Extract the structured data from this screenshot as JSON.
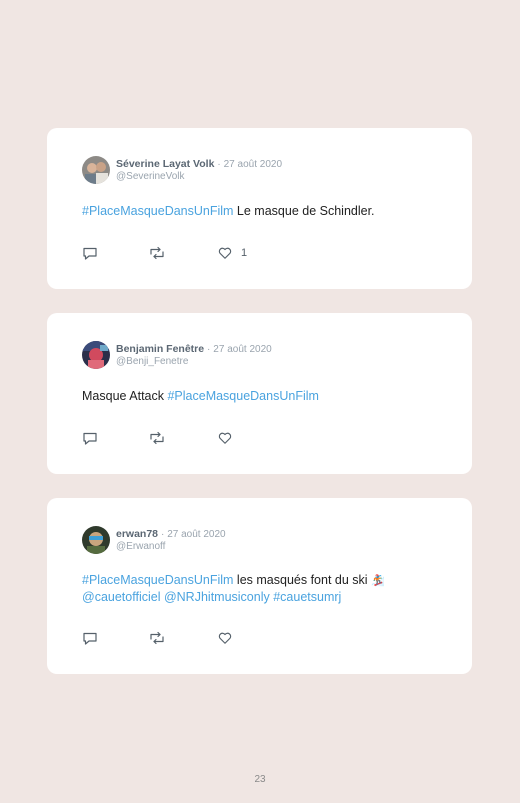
{
  "tweets": [
    {
      "name": "Séverine Layat Volk",
      "date": "27 août 2020",
      "handle": "@SeverineVolk",
      "text_parts": [
        "#PlaceMasqueDansUnFilm",
        " Le masque de Schindler."
      ],
      "like_count": "1"
    },
    {
      "name": "Benjamin Fenêtre",
      "date": "27 août 2020",
      "handle": "@Benji_Fenetre",
      "text_parts": [
        "Masque Attack ",
        "#PlaceMasqueDansUnFilm"
      ]
    },
    {
      "name": "erwan78",
      "date": "27 août 2020",
      "handle": "@Erwanoff",
      "text_parts": [
        "#PlaceMasqueDansUnFilm",
        " les masqués font du ski",
        "🏂"
      ],
      "text_line2": [
        "@cauetofficiel",
        " ",
        "@NRJhitmusiconly",
        " ",
        "#cauetsumrj"
      ]
    }
  ],
  "separator": "·",
  "page_number": "23",
  "icons": {
    "reply": "reply-icon",
    "retweet": "retweet-icon",
    "like": "heart-icon"
  },
  "colors": {
    "background": "#f0e6e3",
    "card": "#ffffff",
    "hashtag": "#4aa3df"
  }
}
